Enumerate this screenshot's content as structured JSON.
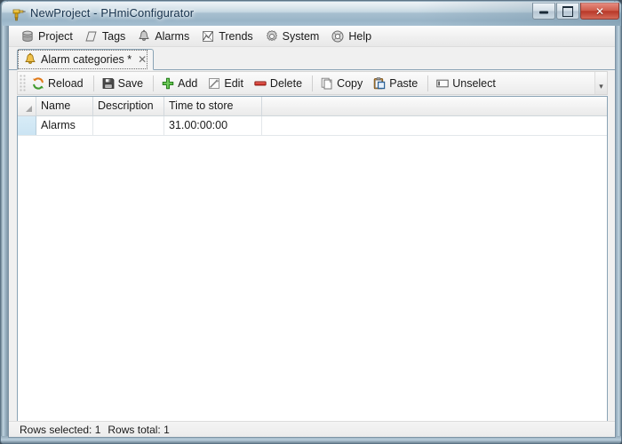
{
  "window": {
    "title": "NewProject - PHmiConfigurator",
    "app_icon": "drill-icon",
    "buttons": {
      "minimize": "minimize-button",
      "maximize": "restore-button",
      "close_glyph": "✕"
    }
  },
  "menubar": {
    "items": [
      {
        "label": "Project",
        "icon": "database-icon"
      },
      {
        "label": "Tags",
        "icon": "tag-icon"
      },
      {
        "label": "Alarms",
        "icon": "bell-icon"
      },
      {
        "label": "Trends",
        "icon": "chart-icon"
      },
      {
        "label": "System",
        "icon": "gear-icon"
      },
      {
        "label": "Help",
        "icon": "lifering-icon"
      }
    ]
  },
  "tabs": {
    "items": [
      {
        "label": "Alarm categories *",
        "icon": "bell-icon",
        "close": "✕",
        "active": true
      }
    ]
  },
  "toolbar": {
    "buttons": [
      {
        "label": "Reload",
        "icon": "refresh-icon"
      },
      {
        "label": "Save",
        "icon": "floppy-disk-icon"
      },
      {
        "label": "Add",
        "icon": "plus-icon"
      },
      {
        "label": "Edit",
        "icon": "pencil-icon"
      },
      {
        "label": "Delete",
        "icon": "minus-red-icon"
      },
      {
        "label": "Copy",
        "icon": "copy-icon"
      },
      {
        "label": "Paste",
        "icon": "clipboard-icon"
      },
      {
        "label": "Unselect",
        "icon": "unselect-icon"
      }
    ],
    "overflow_glyph": "▾"
  },
  "grid": {
    "columns": [
      "Name",
      "Description",
      "Time to store"
    ],
    "rows": [
      {
        "Name": "Alarms",
        "Description": "",
        "Time to store": "31.00:00:00",
        "selected": true
      }
    ]
  },
  "statusbar": {
    "rows_selected": "Rows selected: 1",
    "rows_total": "Rows total: 1"
  },
  "colors": {
    "titlebar": "#b0c7d6",
    "close_button": "#c2503e",
    "accent_selection": "#cbe4f3",
    "frame": "#7e94a5",
    "client_bg": "#f0f0f0"
  }
}
